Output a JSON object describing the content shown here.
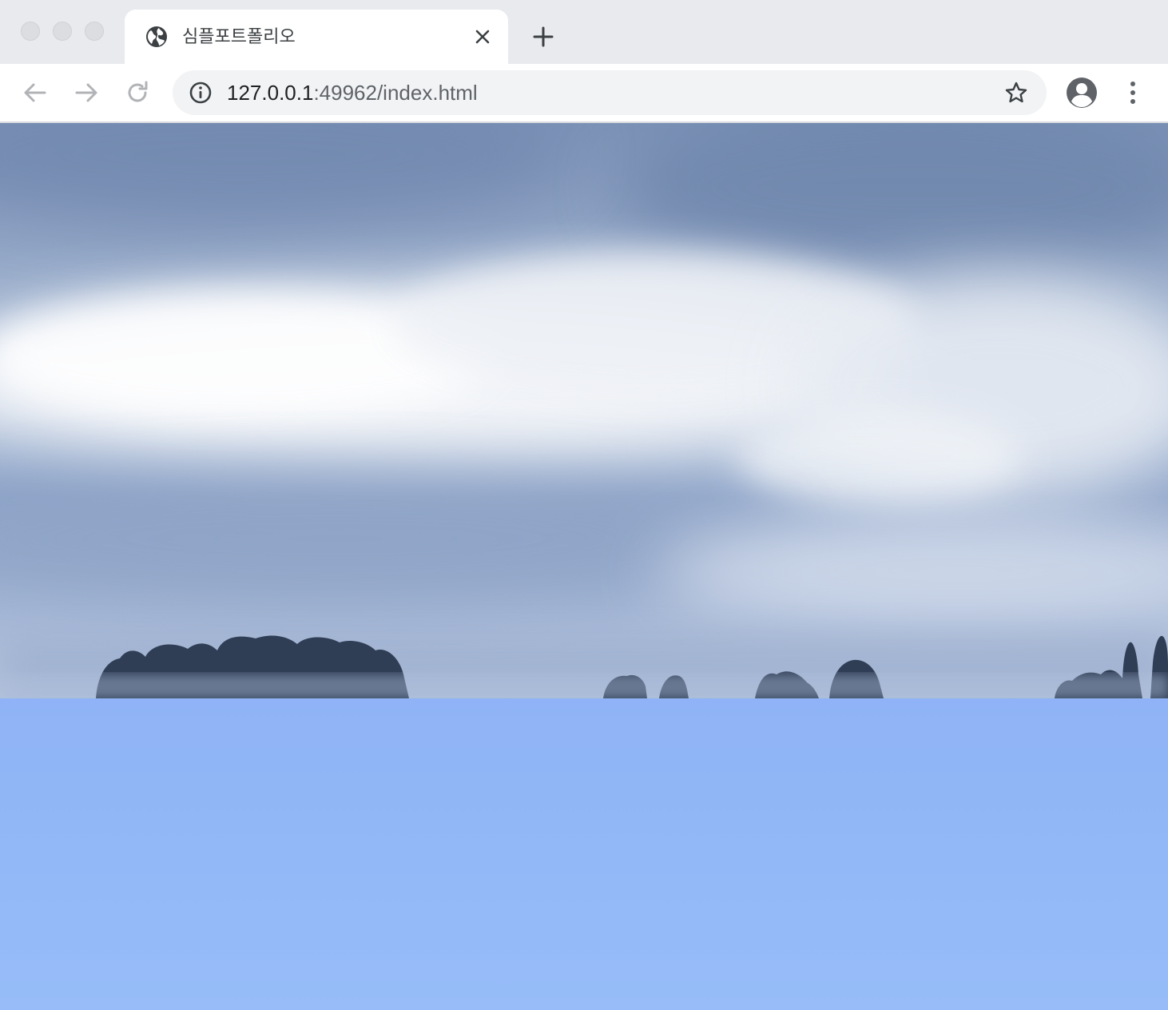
{
  "window": {
    "traffic_lights": [
      "close",
      "minimize",
      "maximize"
    ]
  },
  "tab": {
    "title": "심플포트폴리오",
    "favicon": "globe-icon",
    "close_icon": "close-icon"
  },
  "new_tab_icon": "plus-icon",
  "toolbar": {
    "back_icon": "arrow-left-icon",
    "forward_icon": "arrow-right-icon",
    "reload_icon": "reload-icon",
    "site_info_icon": "info-icon",
    "url_host": "127.0.0.1",
    "url_rest": ":49962/index.html",
    "bookmark_icon": "star-icon",
    "profile_icon": "account-circle-icon",
    "menu_icon": "kebab-menu-icon"
  },
  "page": {
    "hero_image": "cloudy-sky-over-misty-treeline",
    "section_background": "light-blue-sky"
  },
  "colors": {
    "tabstrip": "#e8eaed",
    "omnibox": "#f1f3f4",
    "icon": "#5f6368",
    "sky_section": "#91b6f7"
  }
}
